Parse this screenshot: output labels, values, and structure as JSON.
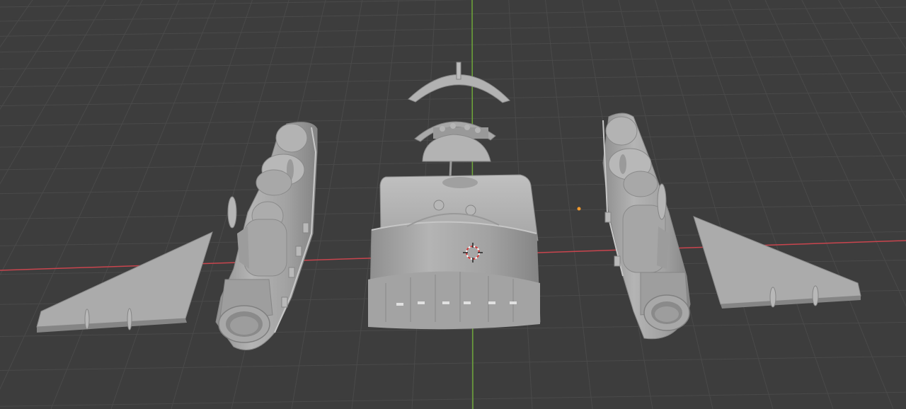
{
  "app": {
    "name": "3D Viewport"
  },
  "viewport": {
    "background_color": "#3d3d3d",
    "grid_color": "#4a4a4a",
    "x_axis_color": "#c9454e",
    "y_axis_color": "#6ea63a",
    "model_color": "#a9a9a9",
    "model_shadow_color": "#7e7e7e",
    "model_highlight_color": "#c4c4c4",
    "origin_color": "#f29a2e"
  },
  "scene": {
    "objects": [
      "left-wing",
      "left-engine-pod",
      "canopy-frame",
      "cockpit-part",
      "center-fuselage",
      "right-engine-pod",
      "right-wing"
    ],
    "cursor": "3d-cursor-icon",
    "origin": "object-origin-icon"
  }
}
